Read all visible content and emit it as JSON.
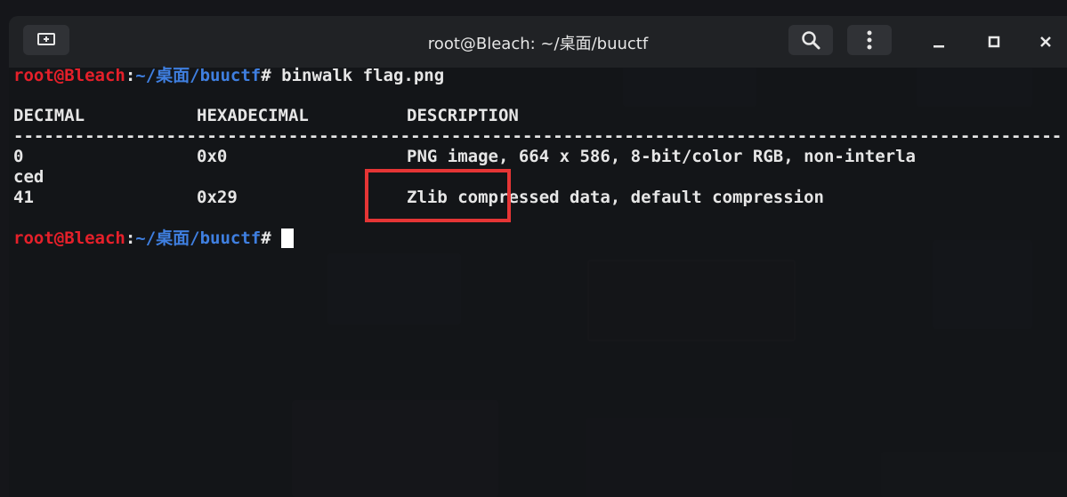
{
  "window": {
    "title": "root@Bleach: ~/桌面/buuctf",
    "new_tab_icon": "new-tab-icon",
    "search_icon": "search-icon",
    "menu_icon": "kebab-menu-icon",
    "minimize_icon": "minimize-icon",
    "maximize_icon": "maximize-icon",
    "close_icon": "close-icon"
  },
  "prompt": {
    "user_host": "root@Bleach",
    "separator": ":",
    "path": "~/桌面/buuctf",
    "symbol": "#"
  },
  "command": " binwalk flag.png",
  "output": {
    "headers": [
      "DECIMAL",
      "HEXADECIMAL",
      "DESCRIPTION"
    ],
    "divider": "--------------------------------------------------------------------------------------------------------------------",
    "rows": [
      {
        "decimal": "0",
        "hex": "0x0",
        "description": "PNG image, 664 x 586, 8-bit/color RGB, non-interla"
      },
      {
        "decimal": "ced",
        "hex": "",
        "description": ""
      },
      {
        "decimal": "41",
        "hex": "0x29",
        "description": "Zlib compressed data, default compression"
      }
    ]
  },
  "colors": {
    "prompt_user": "#e5202a",
    "prompt_path": "#3f7fe0",
    "highlight_box": "#e53535"
  }
}
